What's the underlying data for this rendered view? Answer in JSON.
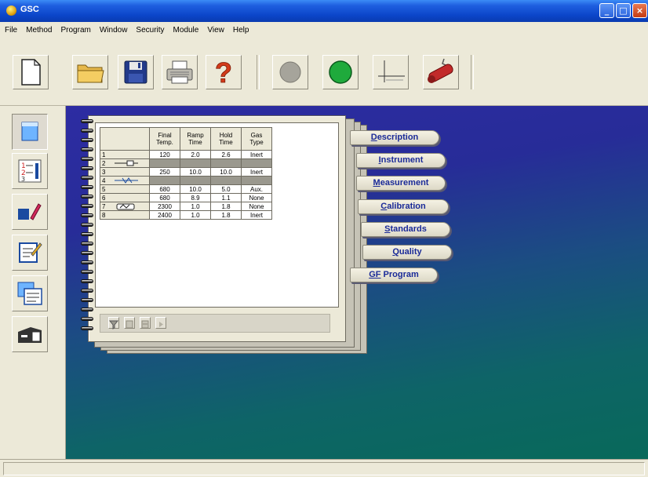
{
  "window": {
    "title": "GSC"
  },
  "menu": [
    "File",
    "Method",
    "Program",
    "Window",
    "Security",
    "Module",
    "View",
    "Help"
  ],
  "toolbar": {
    "buttons": [
      {
        "name": "new-document",
        "icon": "new-document-icon"
      },
      {
        "name": "open-folder",
        "icon": "folder-icon"
      },
      {
        "name": "save",
        "icon": "floppy-disk-icon"
      },
      {
        "name": "print",
        "icon": "printer-icon"
      },
      {
        "name": "help",
        "icon": "question-mark-icon"
      },
      {
        "name": "stop",
        "icon": "grey-circle-icon"
      },
      {
        "name": "start",
        "icon": "green-circle-icon"
      },
      {
        "name": "graph",
        "icon": "axes-graph-icon"
      },
      {
        "name": "furnace",
        "icon": "furnace-tube-icon"
      }
    ]
  },
  "sidebar": {
    "buttons": [
      {
        "name": "beaker",
        "icon": "beaker-icon",
        "pressed": true
      },
      {
        "name": "sequence-list",
        "icon": "numbered-list-icon"
      },
      {
        "name": "sample-tray",
        "icon": "sample-icon"
      },
      {
        "name": "edit-report",
        "icon": "notepad-pencil-icon"
      },
      {
        "name": "data-pages",
        "icon": "stacked-pages-icon"
      },
      {
        "name": "instrument",
        "icon": "instrument-icon"
      }
    ]
  },
  "program_table": {
    "headers": [
      "",
      "Final Temp.",
      "Ramp Time",
      "Hold Time",
      "Gas Type"
    ],
    "rows": [
      {
        "step": "1",
        "final": "120",
        "ramp": "2.0",
        "hold": "2.6",
        "gas": "Inert",
        "grey": false
      },
      {
        "step": "2",
        "final": "",
        "ramp": "",
        "hold": "",
        "gas": "",
        "grey": true,
        "icon": "sample-insert-icon"
      },
      {
        "step": "3",
        "final": "250",
        "ramp": "10.0",
        "hold": "10.0",
        "gas": "Inert",
        "grey": false
      },
      {
        "step": "4",
        "final": "",
        "ramp": "",
        "hold": "",
        "gas": "",
        "grey": true,
        "icon": "modifier-inject-icon"
      },
      {
        "step": "5",
        "final": "680",
        "ramp": "10.0",
        "hold": "5.0",
        "gas": "Aux.",
        "grey": false
      },
      {
        "step": "6",
        "final": "680",
        "ramp": "8.9",
        "hold": "1.1",
        "gas": "None",
        "grey": false
      },
      {
        "step": "7",
        "final": "2300",
        "ramp": "1.0",
        "hold": "1.8",
        "gas": "None",
        "grey": false,
        "icon": "tube-cell-icon"
      },
      {
        "step": "8",
        "final": "2400",
        "ramp": "1.0",
        "hold": "1.8",
        "gas": "Inert",
        "grey": false
      }
    ]
  },
  "tabs": [
    {
      "label_underline": "D",
      "label_rest": "escription"
    },
    {
      "label_underline": "I",
      "label_rest": "nstrument"
    },
    {
      "label_underline": "M",
      "label_rest": "easurement"
    },
    {
      "label_underline": "C",
      "label_rest": "alibration"
    },
    {
      "label_underline": "S",
      "label_rest": "tandards"
    },
    {
      "label_underline": "Q",
      "label_rest": "uality"
    },
    {
      "label_underline": "GF",
      "label_rest": " Program"
    }
  ],
  "colors": {
    "title_bar": "#0b45c9",
    "workspace_top": "#2d2ca2",
    "workspace_bottom": "#08695a",
    "tab_text": "#1a2a98",
    "start_green": "#1faa3c",
    "help_red": "#d23a1a"
  }
}
